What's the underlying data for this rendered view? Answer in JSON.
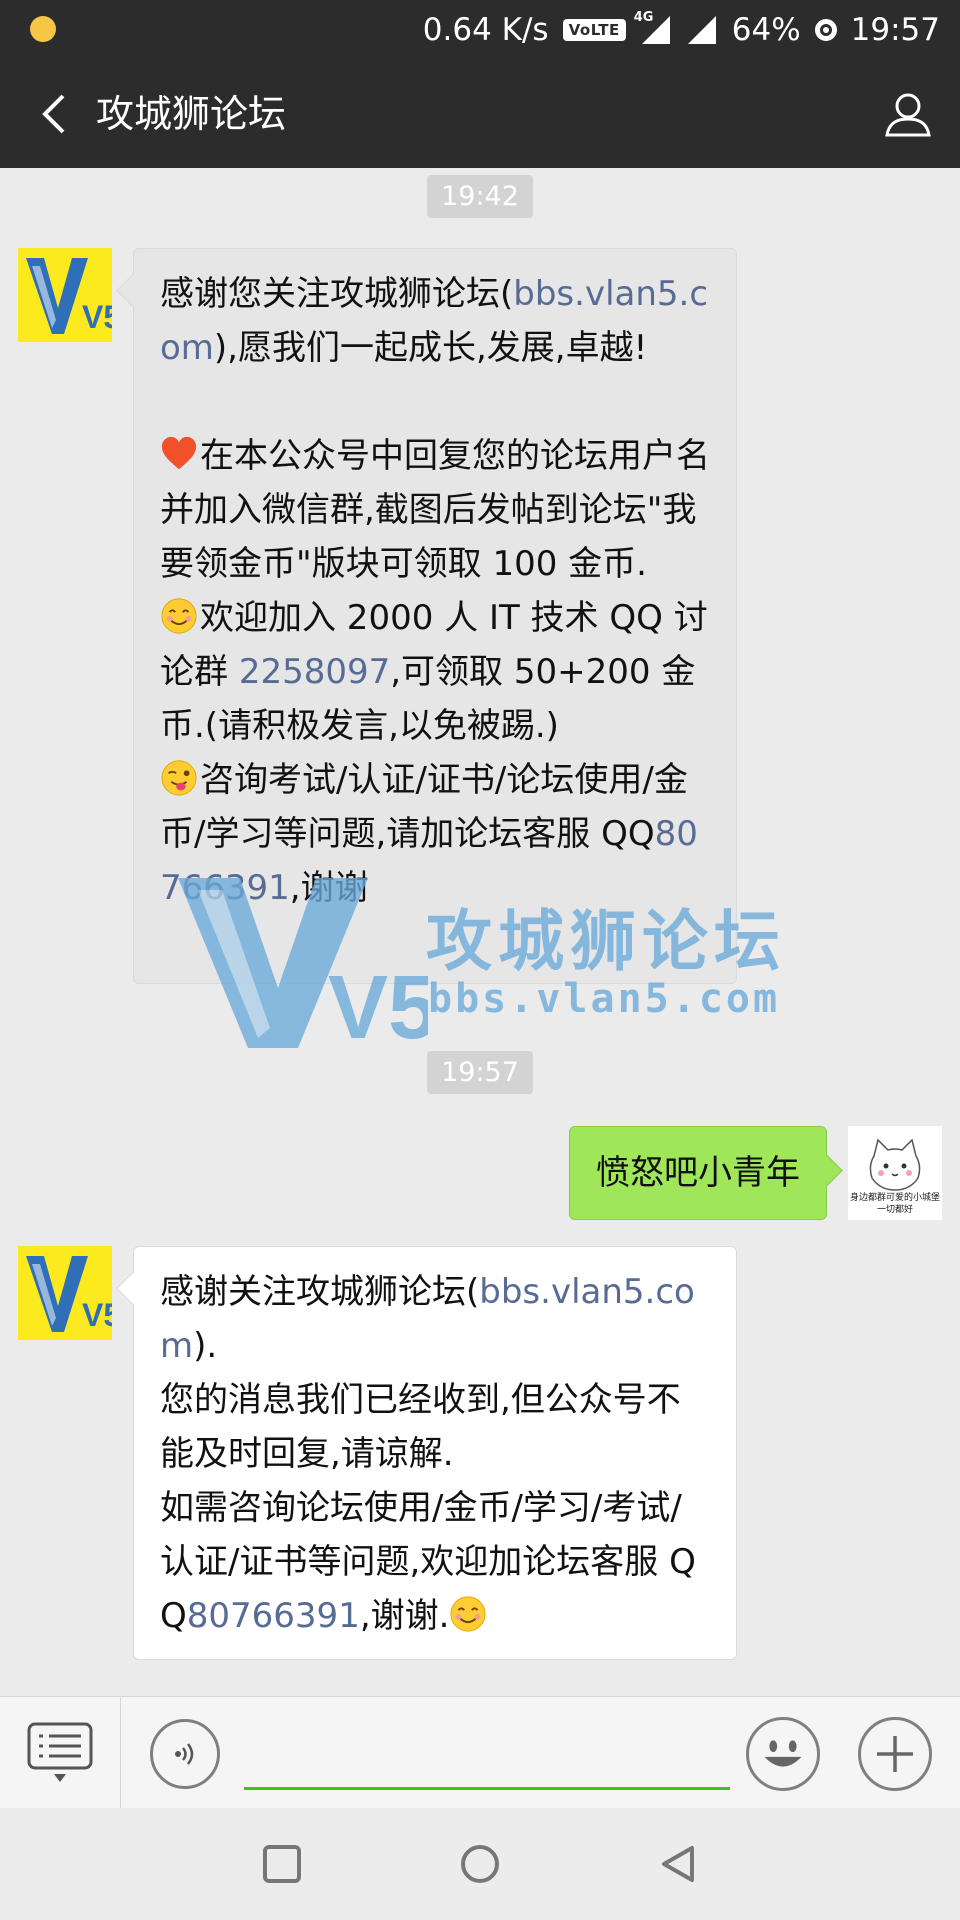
{
  "status_bar": {
    "speed": "0.64 K/s",
    "volte": "VoLTE",
    "network": "4G",
    "battery": "64%",
    "time": "19:57"
  },
  "header": {
    "title": "攻城狮论坛",
    "back_icon": "chevron-left-icon",
    "profile_icon": "person-icon"
  },
  "messages": [
    {
      "type": "timestamp",
      "text": "19:42"
    },
    {
      "type": "incoming",
      "intro_a": "感谢您关注攻城狮论坛(",
      "intro_link": "bbs.vlan5.com",
      "intro_b": "),愿我们一起成长,发展,卓越!",
      "item1": "在本公众号中回复您的论坛用户名并加入微信群,截图后发帖到论坛\"我要领金币\"版块可领取 100 金币.",
      "item2_a": "欢迎加入 2000 人 IT 技术 QQ 讨论群 ",
      "item2_link": "2258097",
      "item2_b": ",可领取 50+200 金币.(请积极发言,以免被踢.)",
      "item3_a": "咨询考试/认证/证书/论坛使用/金币/学习等问题,请加论坛客服 QQ",
      "item3_link": "80766391",
      "item3_b": ",谢谢"
    },
    {
      "type": "timestamp",
      "text": "19:57"
    },
    {
      "type": "outgoing",
      "text": "愤怒吧小青年"
    },
    {
      "type": "incoming",
      "line1_a": "感谢关注攻城狮论坛(",
      "line1_link": "bbs.vlan5.com",
      "line1_b": ").",
      "line2": "您的消息我们已经收到,但公众号不能及时回复,请谅解.",
      "line3_a": "如需咨询论坛使用/金币/学习/考试/认证/证书等问题,欢迎加论坛客服 QQ",
      "line3_link": "80766391",
      "line3_b": ",谢谢."
    }
  ],
  "avatars": {
    "official_logo": "V5",
    "user_caption": "身边都群可爱的小城堡一切都好"
  },
  "watermark": {
    "name": "攻城狮论坛",
    "url": "bbs.vlan5.com",
    "logo": "V5"
  },
  "input_bar": {
    "menu_icon": "keyboard-menu-icon",
    "voice_icon": "voice-icon",
    "emoji_icon": "smiley-icon",
    "plus_icon": "plus-icon",
    "text_value": ""
  },
  "nav_bar": {
    "recent_icon": "square-icon",
    "home_icon": "circle-icon",
    "back_icon": "triangle-back-icon"
  },
  "colors": {
    "bar_bg": "#2c2c2c",
    "chat_bg": "#ebebeb",
    "outgoing_bubble": "#9fe658",
    "link": "#576b95",
    "input_underline": "#45c01a"
  }
}
